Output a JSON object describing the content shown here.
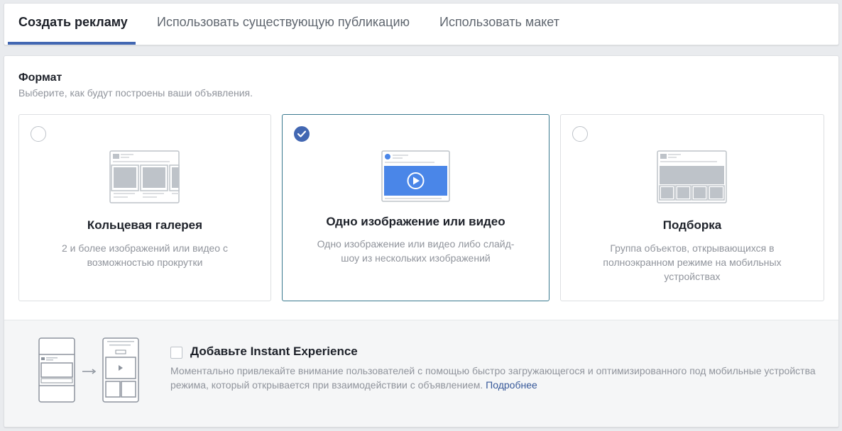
{
  "tabs": [
    {
      "label": "Создать рекламу",
      "active": true
    },
    {
      "label": "Использовать существующую публикацию",
      "active": false
    },
    {
      "label": "Использовать макет",
      "active": false
    }
  ],
  "format": {
    "title": "Формат",
    "subtitle": "Выберите, как будут построены ваши объявления.",
    "options": [
      {
        "title": "Кольцевая галерея",
        "description": "2 и более изображений или видео с возможностью прокрутки",
        "selected": false,
        "icon": "carousel-icon"
      },
      {
        "title": "Одно изображение или видео",
        "description": "Одно изображение или видео либо слайд-шоу из нескольких изображений",
        "selected": true,
        "icon": "single-video-icon"
      },
      {
        "title": "Подборка",
        "description": "Группа объектов, открывающихся в полноэкранном режиме на мобильных устройствах",
        "selected": false,
        "icon": "collection-icon"
      }
    ]
  },
  "instant_experience": {
    "title": "Добавьте Instant Experience",
    "description": "Моментально привлекайте внимание пользователей с помощью быстро загружающегося и оптимизированного под мобильные устройства режима, который открывается при взаимодействии с объявлением.",
    "link": "Подробнее",
    "checked": false
  },
  "colors": {
    "accent": "#4267b2",
    "selected_border": "#3b7a8f",
    "link": "#365899",
    "muted_text": "#90949c"
  }
}
